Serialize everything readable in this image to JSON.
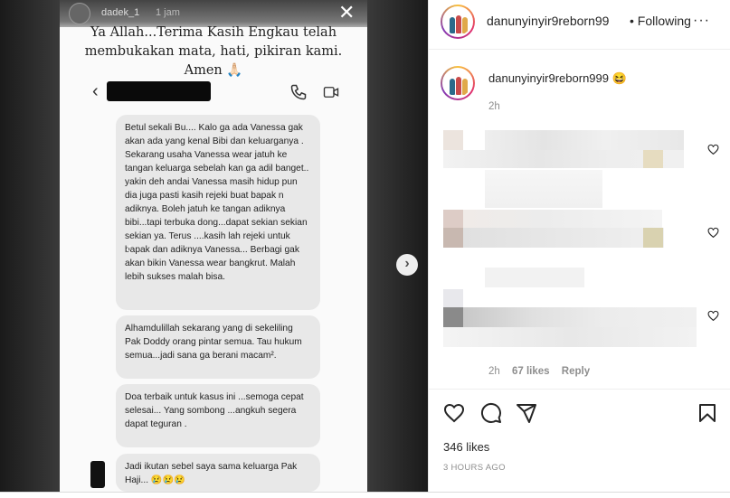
{
  "story": {
    "username": "dadek_1",
    "time": "1 jam",
    "caption_lines": [
      "Ya Allah...Terima Kasih Engkau telah",
      "membukakan mata, hati, pikiran kami.",
      "Amen 🙏🏻"
    ],
    "messages": [
      "Betul sekali Bu.... Kalo ga ada Vanessa gak akan ada yang kenal Bibi dan keluarganya . Sekarang usaha Vanessa wear jatuh ke tangan keluarga sebelah kan ga adil banget.. yakin deh andai Vanessa masih hidup pun dia juga pasti kasih rejeki buat bapak n adiknya. Boleh jatuh ke tangan adiknya bibi...tapi terbuka dong...dapat sekian sekian sekian ya. Terus ....kasih lah rejeki untuk bapak dan adiknya Vanessa... Berbagi gak akan bikin Vanessa wear bangkrut. Malah lebih sukses malah bisa.",
      "Alhamdulillah sekarang yang di sekeliling Pak Doddy orang pintar semua. Tau hukum semua...jadi sana ga berani macam².",
      "Doa terbaik untuk kasus ini ...semoga cepat selesai... Yang sombong ...angkuh segera dapat teguran .",
      "Jadi ikutan sebel saya sama keluarga Pak Haji... 😢😢😢"
    ]
  },
  "post": {
    "account": "danunyinyir9reborn99",
    "follow_sep": "•",
    "follow_label": "Following",
    "more": "···",
    "caption_user": "danunyinyir9reborn999",
    "caption_emoji": "😆",
    "caption_time": "2h",
    "comment3_time": "2h",
    "comment3_likes": "67 likes",
    "comment3_reply": "Reply",
    "likes": "346 likes",
    "posted": "3 HOURS AGO"
  }
}
